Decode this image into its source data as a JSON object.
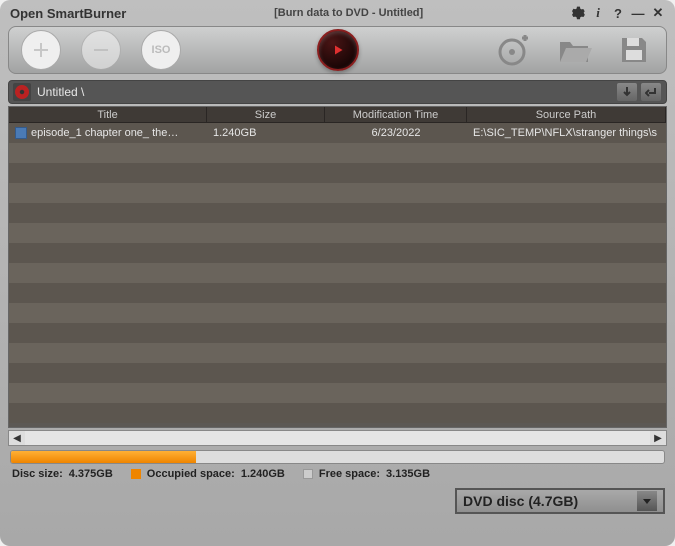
{
  "app": {
    "name": "Open SmartBurner",
    "doc_title": "[Burn data to DVD - Untitled]"
  },
  "breadcrumb": {
    "path": "Untitled \\"
  },
  "columns": {
    "title": "Title",
    "size": "Size",
    "mtime": "Modification Time",
    "path": "Source Path"
  },
  "rows": [
    {
      "title": "episode_1  chapter one_ the…",
      "size": "1.240GB",
      "mtime": "6/23/2022",
      "path": "E:\\SIC_TEMP\\NFLX\\stranger things\\s"
    }
  ],
  "status": {
    "disc_size_label": "Disc size:",
    "disc_size": "4.375GB",
    "occupied_label": "Occupied space:",
    "occupied": "1.240GB",
    "free_label": "Free space:",
    "free": "3.135GB",
    "fill_percent": 28.3
  },
  "disc_select": {
    "value": "DVD disc (4.7GB)"
  }
}
